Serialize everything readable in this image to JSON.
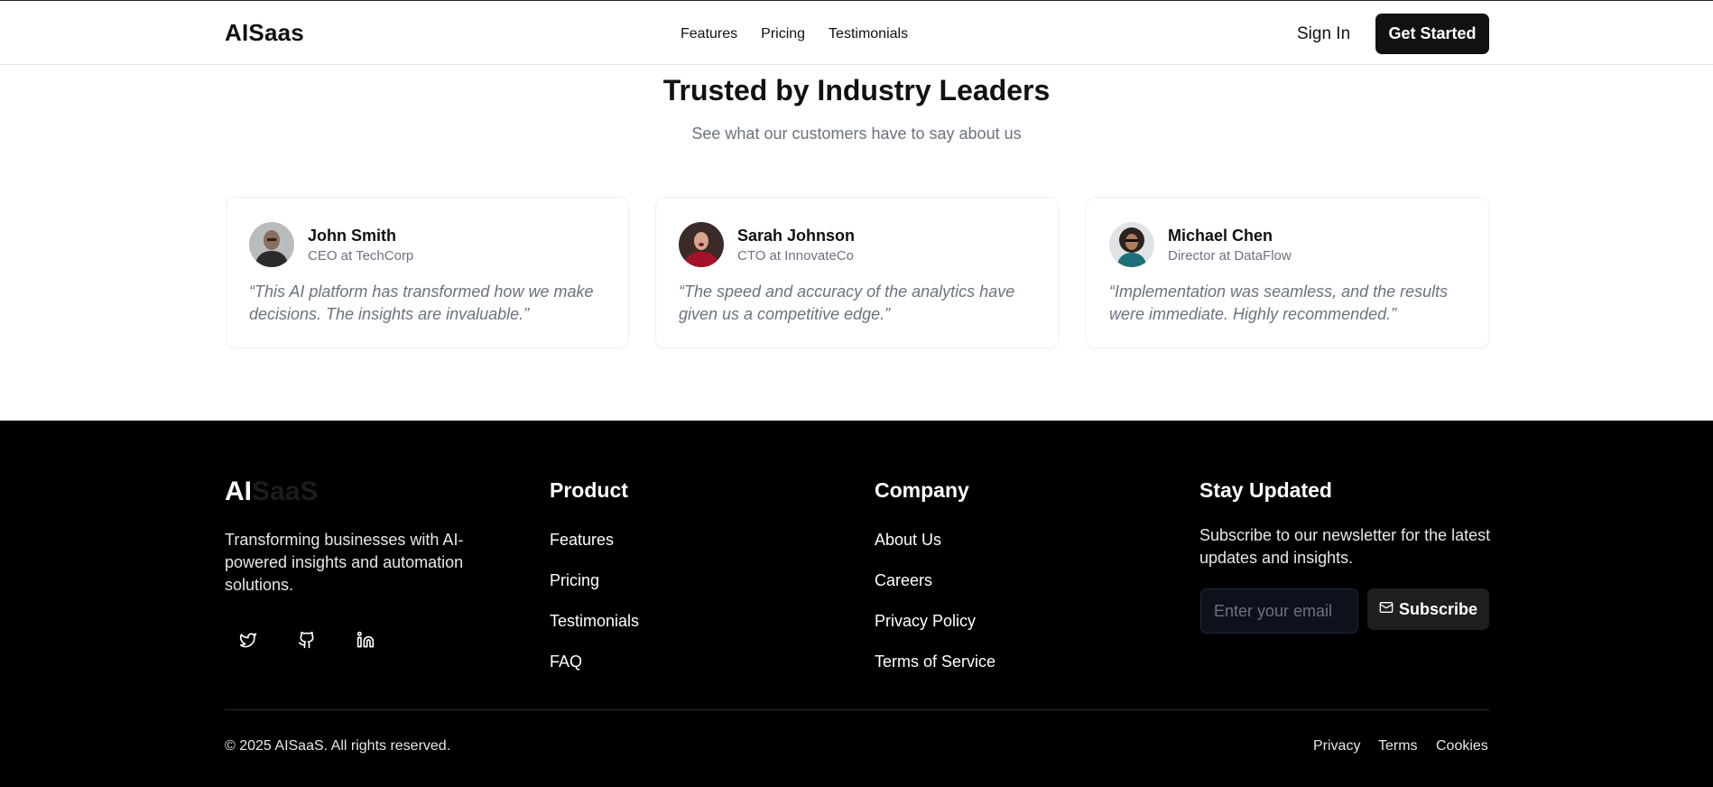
{
  "header": {
    "logo": "AISaas",
    "nav": [
      "Features",
      "Pricing",
      "Testimonials"
    ],
    "sign_in": "Sign In",
    "cta": "Get Started"
  },
  "testimonials": {
    "title": "Trusted by Industry Leaders",
    "subtitle": "See what our customers have to say about us",
    "items": [
      {
        "name": "John Smith",
        "role": "CEO at TechCorp",
        "quote": "“This AI platform has transformed how we make decisions. The insights are invaluable.”"
      },
      {
        "name": "Sarah Johnson",
        "role": "CTO at InnovateCo",
        "quote": "“The speed and accuracy of the analytics have given us a competitive edge.”"
      },
      {
        "name": "Michael Chen",
        "role": "Director at DataFlow",
        "quote": "“Implementation was seamless, and the results were immediate. Highly recommended.”"
      }
    ]
  },
  "footer": {
    "logo_a": "AI",
    "logo_b": "SaaS",
    "description": "Transforming businesses with AI-powered insights and automation solutions.",
    "social": [
      "twitter-icon",
      "github-icon",
      "linkedin-icon"
    ],
    "product": {
      "title": "Product",
      "links": [
        "Features",
        "Pricing",
        "Testimonials",
        "FAQ"
      ]
    },
    "company": {
      "title": "Company",
      "links": [
        "About Us",
        "Careers",
        "Privacy Policy",
        "Terms of Service"
      ]
    },
    "newsletter": {
      "title": "Stay Updated",
      "description": "Subscribe to our newsletter for the latest updates and insights.",
      "placeholder": "Enter your email",
      "button": "Subscribe"
    },
    "copyright": "© 2025 AISaaS. All rights reserved.",
    "legal": [
      "Privacy",
      "Terms",
      "Cookies"
    ]
  }
}
